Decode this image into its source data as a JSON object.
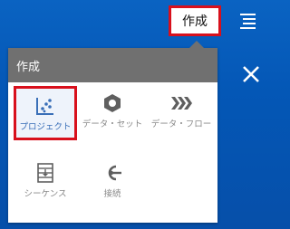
{
  "topbar": {
    "create_button": "作成",
    "menu_icon": "hamburger-menu-icon"
  },
  "create_panel": {
    "title": "作成",
    "items": [
      {
        "label": "プロジェクト",
        "icon": "scatter-plot-icon",
        "selected": true
      },
      {
        "label": "データ・セット",
        "icon": "hexagon-ring-icon",
        "selected": false
      },
      {
        "label": "データ・フロー",
        "icon": "chevrons-right-icon",
        "selected": false
      },
      {
        "label": "シーケンス",
        "icon": "sequence-icon",
        "selected": false
      },
      {
        "label": "接続",
        "icon": "connection-plug-icon",
        "selected": false
      }
    ]
  },
  "colors": {
    "accent_red": "#d8101c",
    "header_gray": "#707070",
    "background_blue": "#0457b6",
    "icon_gray": "#5f5f5f",
    "project_blue": "#3a6fb8"
  }
}
